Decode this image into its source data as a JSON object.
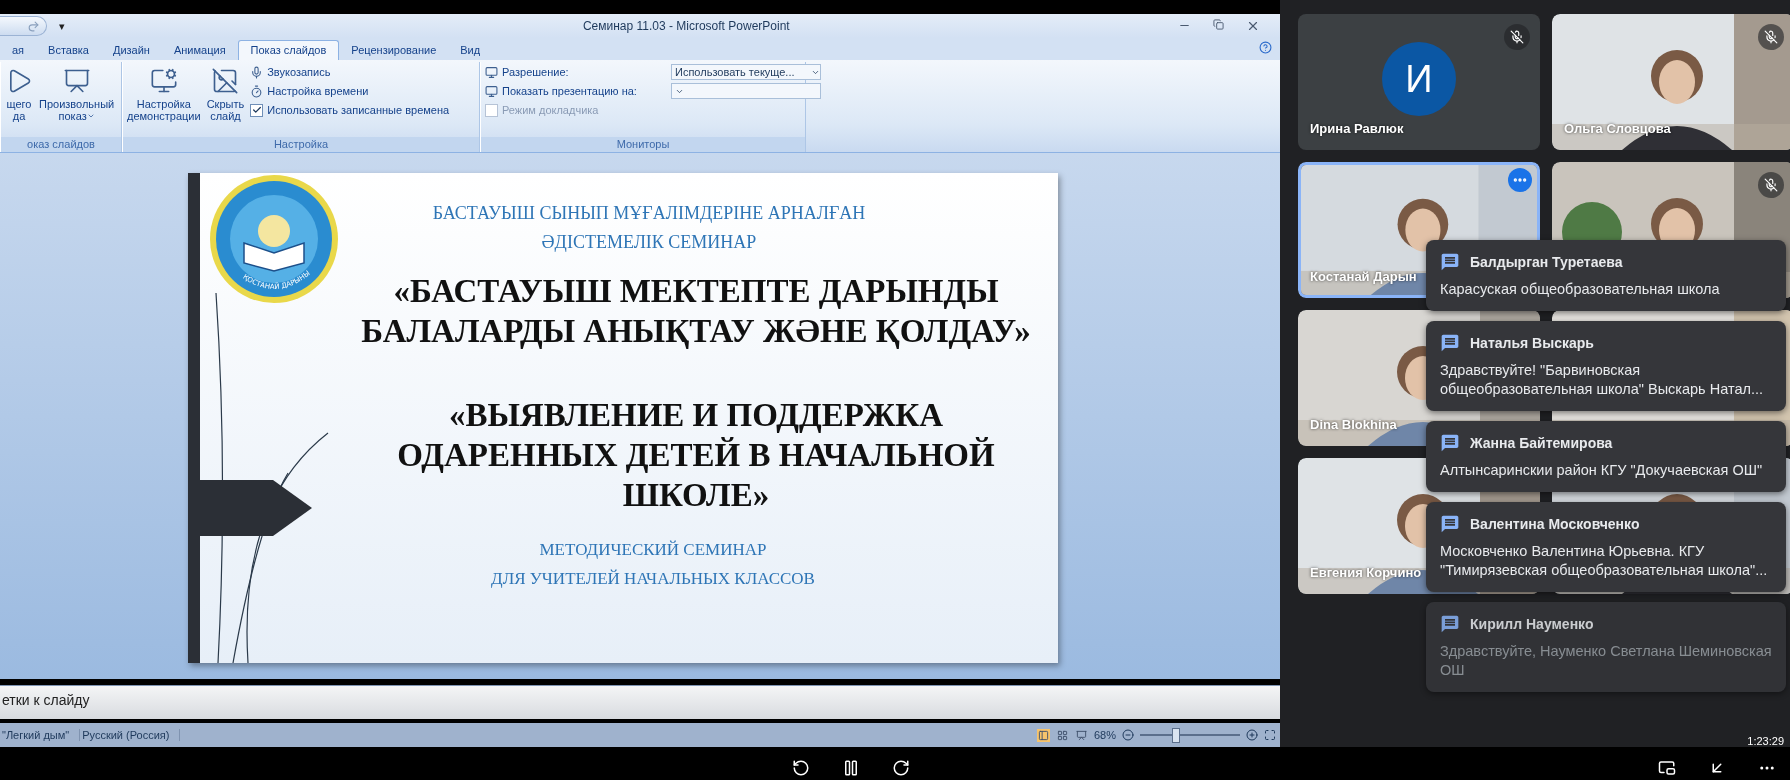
{
  "powerpoint": {
    "quick_access": {
      "menu_glyph": "▾"
    },
    "window_title": "Семинар 11.03 - Microsoft PowerPoint",
    "tabs": [
      {
        "label": "ая",
        "selected": false
      },
      {
        "label": "Вставка",
        "selected": false
      },
      {
        "label": "Дизайн",
        "selected": false
      },
      {
        "label": "Анимация",
        "selected": false
      },
      {
        "label": "Показ слайдов",
        "selected": true
      },
      {
        "label": "Рецензирование",
        "selected": false
      },
      {
        "label": "Вид",
        "selected": false
      }
    ],
    "ribbon_groups": [
      {
        "label": "оказ слайдов",
        "large_buttons": [
          {
            "lines": [
              "щего",
              "да"
            ],
            "dropdown": false
          },
          {
            "lines": [
              "Произвольный",
              "показ"
            ],
            "dropdown": true
          }
        ]
      },
      {
        "label": "Настройка",
        "large_buttons": [
          {
            "lines": [
              "Настройка",
              "демонстрации"
            ],
            "dropdown": false
          },
          {
            "lines": [
              "Скрыть",
              "слайд"
            ],
            "dropdown": false
          }
        ],
        "items": [
          {
            "kind": "command",
            "label": "Звукозапись"
          },
          {
            "kind": "command",
            "label": "Настройка времени"
          },
          {
            "kind": "checkbox",
            "label": "Использовать записанные времена",
            "checked": true,
            "disabled": false
          }
        ]
      },
      {
        "label": "Мониторы",
        "items": [
          {
            "kind": "select",
            "label": "Разрешение:",
            "value": "Использовать текуще..."
          },
          {
            "kind": "select",
            "label": "Показать презентацию на:"
          },
          {
            "kind": "checkbox",
            "label": "Режим докладчика",
            "checked": false,
            "disabled": true
          }
        ]
      }
    ],
    "slide": {
      "logo_caption": "ҚОСТАНАЙ ДАРЫНЫ",
      "heading_lines": [
        "БАСТАУЫШ СЫНЫП МҰҒАЛІМДЕРІНЕ  АРНАЛҒАН",
        "ӘДІСТЕМЕЛІК СЕМИНАР"
      ],
      "titles": [
        [
          "«БАСТАУЫШ МЕКТЕПТЕ ДАРЫНДЫ",
          "БАЛАЛАРДЫ АНЫҚТАУ ЖӘНЕ ҚОЛДАУ»"
        ],
        [
          "«ВЫЯВЛЕНИЕ И ПОДДЕРЖКА",
          "ОДАРЕННЫХ ДЕТЕЙ В НАЧАЛЬНОЙ",
          "ШКОЛЕ»"
        ]
      ],
      "footer_lines": [
        "МЕТОДИЧЕСКИЙ СЕМИНАР",
        "ДЛЯ УЧИТЕЛЕЙ НАЧАЛЬНЫХ КЛАССОВ"
      ]
    },
    "notes": "етки к слайду",
    "status_bar": {
      "items": [
        "\"Легкий дым\"",
        "Русский (Россия)"
      ],
      "views": [
        {
          "selected": true
        },
        {
          "selected": false
        },
        {
          "selected": false
        }
      ],
      "zoom": "68%",
      "zoom_slider": {
        "level": 0.35
      }
    }
  },
  "meet": {
    "participants": [
      {
        "kind": "avatar",
        "initial": "И",
        "name": "Ирина Равлюк",
        "mic_muted": true,
        "selected": false
      },
      {
        "kind": "video",
        "name": "Ольга Словцова",
        "mic_muted": true,
        "selected": false
      },
      {
        "kind": "video",
        "name": "Костанай Дарын",
        "mic_muted": false,
        "selected": true
      },
      {
        "kind": "video",
        "mic_muted": true,
        "selected": false
      },
      {
        "kind": "video",
        "name": "Dina Blokhina",
        "mic_muted": false,
        "selected": false
      },
      {
        "kind": "video",
        "mic_muted": false,
        "selected": false
      },
      {
        "kind": "video",
        "name": "Евгения Корчино",
        "mic_muted": false,
        "selected": false
      },
      {
        "kind": "video",
        "mic_muted": false,
        "selected": false
      }
    ],
    "chat_notifications": [
      {
        "sender": "Балдырган Туретаева",
        "message": "Карасуская общеобразовательная школа",
        "fading": false
      },
      {
        "sender": "Наталья Выскарь",
        "message": "Здравствуйте! \"Барвиновская общеобразовательная школа\" Выскарь Натал...",
        "fading": false
      },
      {
        "sender": "Жанна Байтемирова",
        "message": "Алтынсаринскии район КГУ \"Докучаевская ОШ\"",
        "fading": false
      },
      {
        "sender": "Валентина Московченко",
        "message": "Московченко Валентина Юрьевна. КГУ \"Тимирязевская общеобразовательная школа\"...",
        "fading": false
      },
      {
        "sender": "Кирилл Науменко",
        "message": "Здравствуйте, Науменко Светлана Шеминовская ОШ",
        "fading": true
      }
    ],
    "time": "1:23:29"
  }
}
